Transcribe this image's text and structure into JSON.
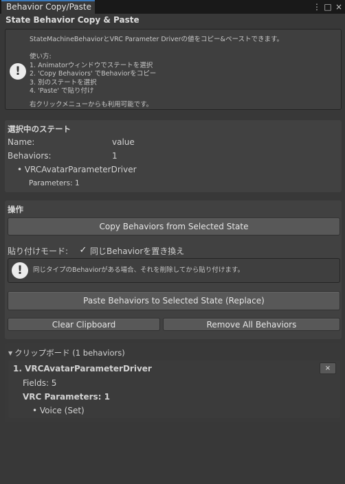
{
  "window": {
    "tab_title": "Behavior Copy/Paste",
    "title": "State Behavior Copy & Paste"
  },
  "help": {
    "intro": "StateMachineBehaviorとVRC Parameter Driverの値をコピー&ペーストできます。",
    "usage_title": "使い方:",
    "steps": [
      "1. Animatorウィンドウでステートを選択",
      "2. 'Copy Behaviors' でBehaviorをコピー",
      "3. 別のステートを選択",
      "4. 'Paste' で貼り付け"
    ],
    "context_menu": "右クリックメニューからも利用可能です。"
  },
  "selected_state": {
    "header": "選択中のステート",
    "name_label": "Name:",
    "name_value": "value",
    "behaviors_label": "Behaviors:",
    "behaviors_value": "1",
    "behavior_item": "• VRCAvatarParameterDriver",
    "parameters_text": "Parameters: 1"
  },
  "operations": {
    "header": "操作",
    "copy_button": "Copy Behaviors from Selected State",
    "paste_mode_label": "貼り付けモード:",
    "replace_checkbox_label": "同じBehaviorを置き換え",
    "replace_checked": true,
    "replace_help": "同じタイプのBehaviorがある場合、それを削除してから貼り付けます。",
    "paste_button": "Paste Behaviors to Selected State (Replace)",
    "clear_button": "Clear Clipboard",
    "remove_button": "Remove All Behaviors"
  },
  "clipboard": {
    "foldout_label": "クリップボード (1 behaviors)",
    "item_title": "1. VRCAvatarParameterDriver",
    "fields_text": "Fields: 5",
    "vrc_params_text": "VRC Parameters: 1",
    "param_item": "• Voice (Set)",
    "remove_item_glyph": "×"
  },
  "icons": {
    "warning": "!",
    "check": "✓",
    "menu": "⋮",
    "maximize": "□",
    "close": "×",
    "foldout_open": "▼"
  }
}
